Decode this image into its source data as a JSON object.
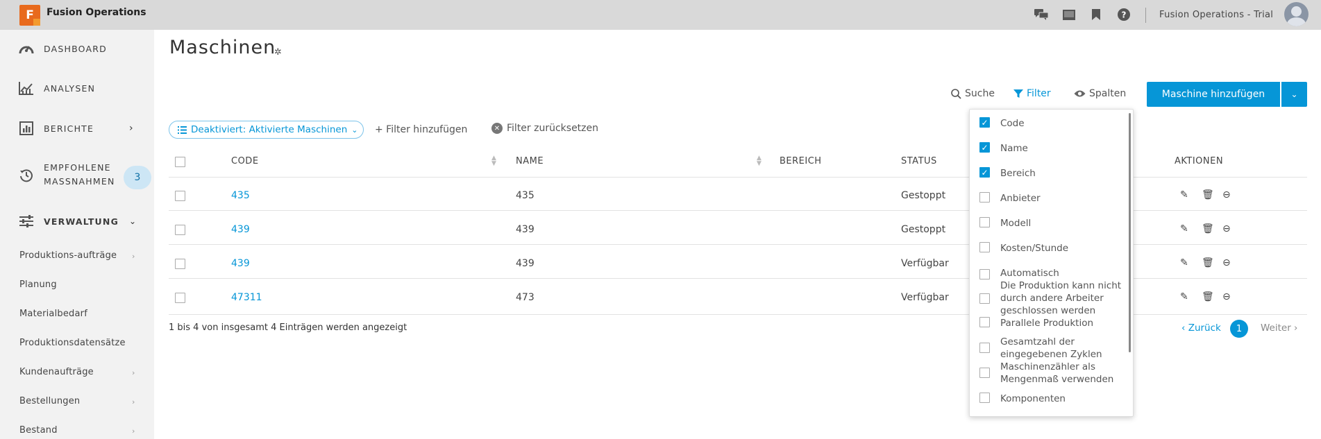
{
  "topbar": {
    "logo_letter": "F",
    "app_title": "Fusion Operations",
    "account": "Fusion Operations - Trial",
    "icons": [
      "chat-icon",
      "screen-icon",
      "bookmark-icon",
      "help-icon"
    ]
  },
  "sidebar": {
    "main_items": [
      {
        "label": "DASHBOARD",
        "icon": "speedometer-icon"
      },
      {
        "label": "ANALYSEN",
        "icon": "chart-line-icon"
      },
      {
        "label": "BERICHTE",
        "icon": "report-icon"
      },
      {
        "label_line1": "EMPFOHLENE",
        "label_line2": "MASSNAHMEN",
        "icon": "history-icon",
        "badge": "3"
      },
      {
        "label": "VERWALTUNG",
        "icon": "sliders-icon"
      }
    ],
    "sub_items": [
      "Produktions-aufträge",
      "Planung",
      "Materialbedarf",
      "Produktionsdatensätze",
      "Kundenaufträge",
      "Bestellungen",
      "Bestand"
    ]
  },
  "main": {
    "title": "Maschinen",
    "toolbar": {
      "search": "Suche",
      "filter": "Filter",
      "columns": "Spalten",
      "add_button": "Maschine hinzufügen"
    },
    "active_filter": "Deaktiviert: Aktivierte Maschinen",
    "add_filter": "+ Filter hinzufügen",
    "reset_filter": "Filter zurücksetzen",
    "table": {
      "headers": {
        "code": "CODE",
        "name": "NAME",
        "area": "BEREICH",
        "status": "STATUS",
        "actions": "AKTIONEN"
      },
      "rows": [
        {
          "code": "435",
          "name": "435",
          "status": "Gestoppt"
        },
        {
          "code": "439",
          "name": "439",
          "status": "Gestoppt"
        },
        {
          "code": "439",
          "name": "439",
          "status": "Verfügbar"
        },
        {
          "code": "47311",
          "name": "473",
          "status": "Verfügbar"
        }
      ]
    },
    "footer": {
      "info": "1 bis 4 von insgesamt 4 Einträgen werden angezeigt",
      "prev": "‹ Zurück",
      "page": "1",
      "next": "Weiter ›"
    }
  },
  "column_dropdown": {
    "items": [
      {
        "label": "Code",
        "checked": true
      },
      {
        "label": "Name",
        "checked": true
      },
      {
        "label": "Bereich",
        "checked": true
      },
      {
        "label": "Anbieter",
        "checked": false
      },
      {
        "label": "Modell",
        "checked": false
      },
      {
        "label": "Kosten/Stunde",
        "checked": false
      },
      {
        "label": "Automatisch",
        "checked": false
      },
      {
        "label": "Die Produktion kann nicht durch andere Arbeiter geschlossen werden",
        "checked": false
      },
      {
        "label": "Parallele Produktion",
        "checked": false
      },
      {
        "label": "Gesamtzahl der eingegebenen Zyklen",
        "checked": false
      },
      {
        "label": "Maschinenzähler als Mengenmaß verwenden",
        "checked": false
      },
      {
        "label": "Komponenten",
        "checked": false
      }
    ]
  },
  "colors": {
    "accent": "#0696d7",
    "logo": "#e86a1d",
    "sidebar_bg": "#f2f2f2",
    "topbar_bg": "#d9d9d9"
  }
}
